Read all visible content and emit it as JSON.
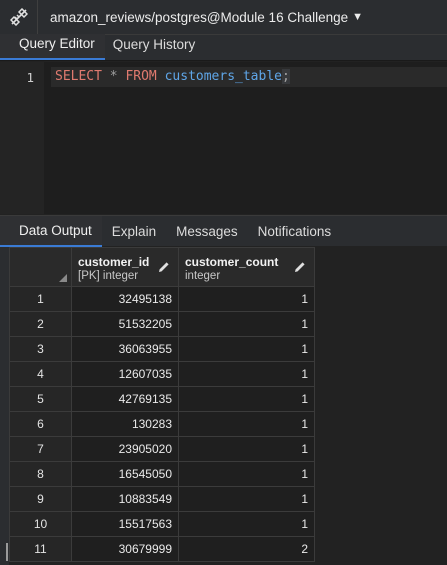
{
  "connection": {
    "title": "amazon_reviews/postgres@Module 16 Challenge",
    "icon": "unplug-icon"
  },
  "top_tabs": [
    {
      "label": "Query Editor",
      "active": true
    },
    {
      "label": "Query History",
      "active": false
    }
  ],
  "editor": {
    "line_number": "1",
    "tokens": {
      "select": "SELECT",
      "star": "*",
      "from": "FROM",
      "table": "customers_table",
      "semicolon": ";"
    }
  },
  "bottom_tabs": [
    {
      "label": "Data Output",
      "active": true
    },
    {
      "label": "Explain",
      "active": false
    },
    {
      "label": "Messages",
      "active": false
    },
    {
      "label": "Notifications",
      "active": false
    }
  ],
  "grid": {
    "columns": [
      {
        "name": "customer_id",
        "type": "[PK] integer"
      },
      {
        "name": "customer_count",
        "type": "integer"
      }
    ],
    "rows": [
      [
        "1",
        "32495138",
        "1"
      ],
      [
        "2",
        "51532205",
        "1"
      ],
      [
        "3",
        "36063955",
        "1"
      ],
      [
        "4",
        "12607035",
        "1"
      ],
      [
        "5",
        "42769135",
        "1"
      ],
      [
        "6",
        "130283",
        "1"
      ],
      [
        "7",
        "23905020",
        "1"
      ],
      [
        "8",
        "16545050",
        "1"
      ],
      [
        "9",
        "10883549",
        "1"
      ],
      [
        "10",
        "15517563",
        "1"
      ],
      [
        "11",
        "30679999",
        "2"
      ]
    ]
  },
  "colors": {
    "accent": "#3a7bd5",
    "keyword": "#e07a6f",
    "identifier": "#5fa6e8"
  }
}
